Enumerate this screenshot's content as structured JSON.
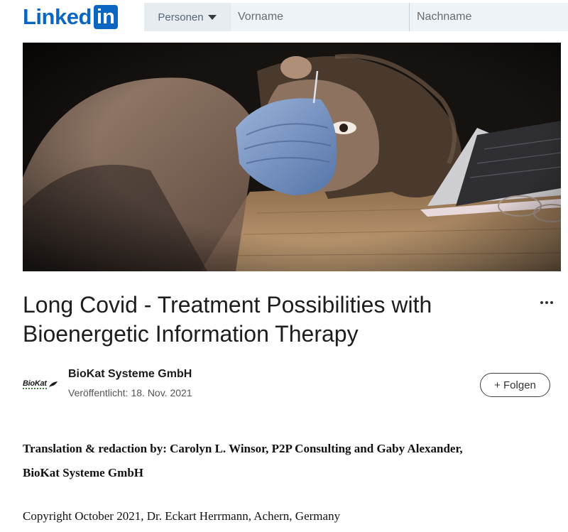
{
  "header": {
    "logo": {
      "wordmark": "Linked",
      "box_text": "in",
      "brand_color": "#0a66c2"
    },
    "search": {
      "filter_label": "Personen",
      "first_name_placeholder": "Vorname",
      "last_name_placeholder": "Nachname"
    }
  },
  "hero": {
    "alt": "Person wearing a blue surgical mask lying head down on a wooden desk next to a laptop and glasses"
  },
  "article": {
    "title": "Long Covid - Treatment Possibilities with Bioenergetic Information Therapy",
    "more_icon": "ellipsis-icon",
    "author": {
      "logo_text": "BioKat",
      "name": "BioKat Systeme GmbH",
      "published": "Veröffentlicht: 18. Nov. 2021"
    },
    "follow_label": "+ Folgen",
    "credits_line1": "Translation & redaction by: Carolyn L. Winsor, P2P Consulting and Gaby Alexander,",
    "credits_line2": "BioKat Systeme GmbH",
    "copyright": "Copyright October 2021, Dr. Eckart Herrmann, Achern, Germany"
  }
}
